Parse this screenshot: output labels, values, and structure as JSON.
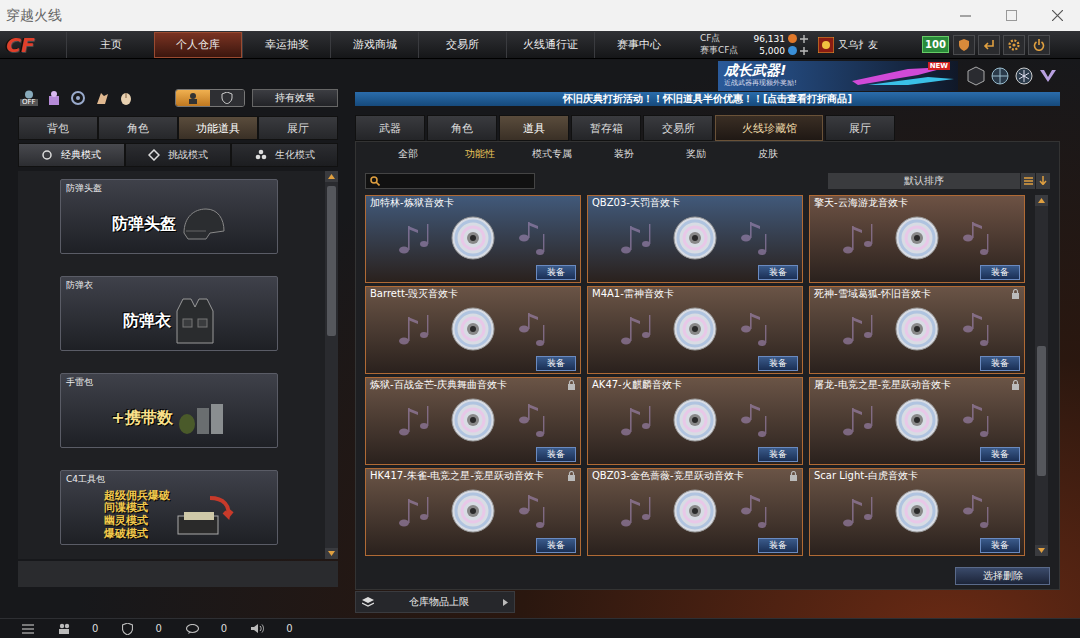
{
  "window": {
    "title": "穿越火线"
  },
  "logo": "CF",
  "nav": {
    "tabs": [
      {
        "label": "主页",
        "selected": false
      },
      {
        "label": "个人仓库",
        "selected": true
      },
      {
        "label": "幸运抽奖",
        "selected": false
      },
      {
        "label": "游戏商城",
        "selected": false
      },
      {
        "label": "交易所",
        "selected": false
      },
      {
        "label": "火线通行证",
        "selected": false
      },
      {
        "label": "赛事中心",
        "selected": false
      }
    ]
  },
  "currency": [
    {
      "label": "CF点",
      "value": "96,131",
      "color": "#e0782a"
    },
    {
      "label": "赛事CF点",
      "value": "5,000",
      "color": "#3a8fd8"
    }
  ],
  "player": {
    "name": "又乌扌友",
    "level": "100"
  },
  "left": {
    "off_label": "OFF",
    "view_toggle": [
      {
        "selected": true
      },
      {
        "selected": false
      }
    ],
    "effect_button": "持有效果",
    "tabs": [
      {
        "label": "背包",
        "selected": false
      },
      {
        "label": "角色",
        "selected": false
      },
      {
        "label": "功能道具",
        "selected": true
      },
      {
        "label": "展厅",
        "selected": false
      }
    ],
    "modes": [
      {
        "label": "经典模式",
        "selected": true
      },
      {
        "label": "挑战模式",
        "selected": false
      },
      {
        "label": "生化模式",
        "selected": false
      }
    ],
    "items": [
      {
        "label": "防弹头盔",
        "kind": "helmet",
        "lines": [
          "防弹头盔"
        ]
      },
      {
        "label": "防弹衣",
        "kind": "vest",
        "lines": [
          "防弹衣"
        ]
      },
      {
        "label": "手雷包",
        "kind": "grenade",
        "lines": [
          "+携带数"
        ]
      },
      {
        "label": "C4工具包",
        "kind": "c4",
        "lines": [
          "超级佣兵爆破",
          "间谍模式",
          "幽灵模式",
          "爆破模式"
        ]
      }
    ]
  },
  "banner": {
    "title": "成长武器!",
    "subtitle": "近战武器再现额外奖励!",
    "badge": "NEW"
  },
  "notice": "怀旧庆典打折活动！！怀旧道具半价优惠！！[点击查看打折商品]",
  "right": {
    "tabs": [
      {
        "label": "武器",
        "selected": false,
        "kind": "normal"
      },
      {
        "label": "角色",
        "selected": false,
        "kind": "normal"
      },
      {
        "label": "道具",
        "selected": true,
        "kind": "normal"
      },
      {
        "label": "暂存箱",
        "selected": false,
        "kind": "normal"
      },
      {
        "label": "交易所",
        "selected": false,
        "kind": "normal"
      },
      {
        "label": "火线珍藏馆",
        "selected": false,
        "kind": "special"
      },
      {
        "label": "展厅",
        "selected": false,
        "kind": "normal"
      }
    ],
    "subtabs": [
      {
        "label": "全部",
        "selected": false
      },
      {
        "label": "功能性",
        "selected": true
      },
      {
        "label": "模式专属",
        "selected": false
      },
      {
        "label": "装扮",
        "selected": false
      },
      {
        "label": "奖励",
        "selected": false
      },
      {
        "label": "皮肤",
        "selected": false
      }
    ],
    "sort": "默认排序",
    "equip_label": "装备",
    "items": [
      {
        "name": "加特林-炼狱音效卡",
        "locked": false,
        "color": "#41597a"
      },
      {
        "name": "QBZ03-天罚音效卡",
        "locked": false,
        "color": "#41597a"
      },
      {
        "name": "擎天-云海游龙音效卡",
        "locked": false,
        "color": "#6d5244"
      },
      {
        "name": "Barrett-毁灭音效卡",
        "locked": false,
        "color": "#6a5446"
      },
      {
        "name": "M4A1-雷神音效卡",
        "locked": false,
        "color": "#6a5446"
      },
      {
        "name": "死神-雪域葛狐-怀旧音效卡",
        "locked": true,
        "color": "#6a5446"
      },
      {
        "name": "炼狱-百战金芒-庆典舞曲音效卡",
        "locked": true,
        "color": "#6a5446"
      },
      {
        "name": "AK47-火麒麟音效卡",
        "locked": false,
        "color": "#6a5446"
      },
      {
        "name": "屠龙-电竞之星-竞星跃动音效卡",
        "locked": true,
        "color": "#6a5446"
      },
      {
        "name": "HK417-朱雀-电竞之星-竞星跃动音效卡",
        "locked": true,
        "color": "#6a5446"
      },
      {
        "name": "QBZ03-金色蔷薇-竞星跃动音效卡",
        "locked": true,
        "color": "#6a5446"
      },
      {
        "name": "Scar Light-白虎音效卡",
        "locked": false,
        "color": "#6a5446"
      }
    ],
    "delete_button": "选择删除",
    "capacity": "仓库物品上限"
  },
  "status_bar": {
    "items": [
      {
        "kind": "people",
        "value": "0"
      },
      {
        "kind": "shield",
        "value": "0"
      },
      {
        "kind": "chat",
        "value": "0"
      },
      {
        "kind": "speaker",
        "value": "0"
      }
    ]
  }
}
